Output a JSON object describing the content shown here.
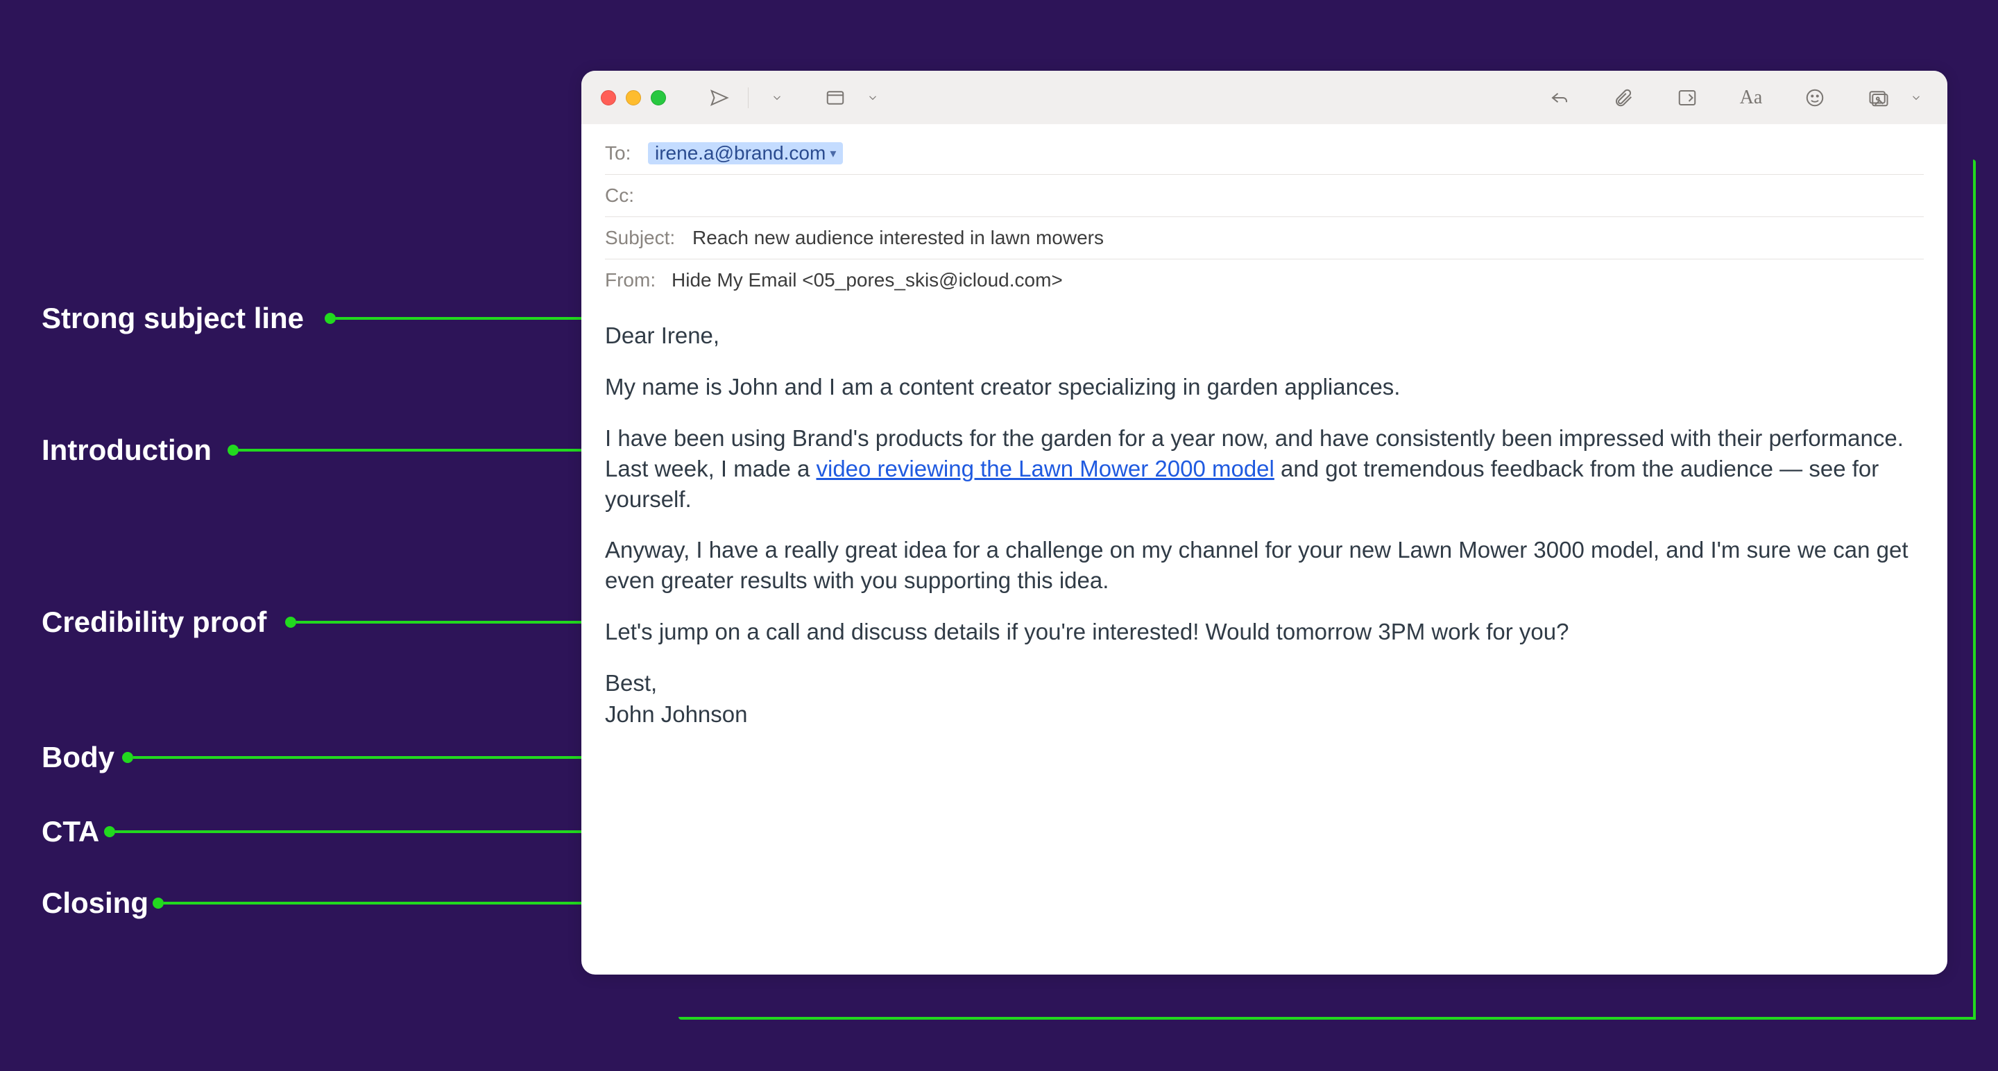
{
  "annotations": {
    "subject": "Strong subject line",
    "intro": "Introduction",
    "credibility": "Credibility proof",
    "body": "Body",
    "cta": "CTA",
    "closing": "Closing"
  },
  "header": {
    "to_label": "To:",
    "to_value": "irene.a@brand.com",
    "cc_label": "Cc:",
    "subject_label": "Subject:",
    "subject_value": "Reach new audience interested in lawn mowers",
    "from_label": "From:",
    "from_value": "Hide My Email <05_pores_skis@icloud.com>"
  },
  "toolbar": {
    "font_label": "Aa"
  },
  "email": {
    "salutation": "Dear Irene,",
    "p_intro": "My name is John and I am a content creator specializing in garden appliances.",
    "p_cred_before": "I have been using Brand's products for the garden for a year now, and have consistently been impressed with their performance. Last week, I made a ",
    "p_cred_link": "video reviewing the Lawn Mower 2000 model",
    "p_cred_after": " and got tremendous feedback from the audience — see for yourself.",
    "p_body": "Anyway, I have a really great idea for a challenge on my channel for your new Lawn Mower 3000 model, and I'm sure we can get even greater results with you supporting this idea.",
    "p_cta": "Let's jump on a call and discuss details if you're interested! Would tomorrow 3PM work for you?",
    "sig_best": "Best,",
    "sig_name": "John Johnson"
  }
}
